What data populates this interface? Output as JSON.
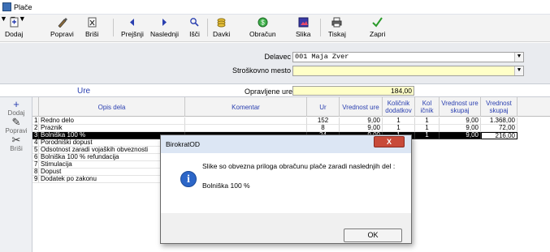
{
  "window": {
    "title": "Plače"
  },
  "toolbar": {
    "buttons": [
      {
        "label": "Dodaj"
      },
      {
        "label": "Popravi"
      },
      {
        "label": "Briši"
      },
      {
        "label": "Prejšnji"
      },
      {
        "label": "Naslednji"
      },
      {
        "label": "Išči"
      },
      {
        "label": "Davki"
      },
      {
        "label": "Obračun"
      },
      {
        "label": "Slika"
      },
      {
        "label": "Tiskaj"
      },
      {
        "label": "Zapri"
      }
    ]
  },
  "form": {
    "delavec_label": "Delavec",
    "delavec_value": "001 Maja Zver",
    "stroskovno_label": "Stroškovno mesto",
    "stroskovno_value": ""
  },
  "ure_section": {
    "title": "Ure",
    "opravljene_label": "Opravljene ure",
    "opravljene_value": "184,00"
  },
  "side_actions": [
    {
      "label": "Dodaj"
    },
    {
      "label": "Popravi"
    },
    {
      "label": "Briši"
    }
  ],
  "table": {
    "headers": [
      "",
      "Opis dela",
      "Komentar",
      "Ur",
      "Vrednost ure",
      "Količnik dodatkov",
      "Kol ičnik",
      "Vrednost ure skupaj",
      "Vrednost skupaj"
    ],
    "rows": [
      {
        "n": "1",
        "opis": "Redno delo",
        "komentar": "",
        "ur": "152",
        "vrure": "9,00",
        "koldod": "1",
        "kol": "1",
        "vrskup": "9,00",
        "skupaj": "1.368,00"
      },
      {
        "n": "2",
        "opis": "Praznik",
        "komentar": "",
        "ur": "8",
        "vrure": "9,00",
        "koldod": "1",
        "kol": "1",
        "vrskup": "9,00",
        "skupaj": "72,00"
      },
      {
        "n": "3",
        "opis": "Bolniška 100 %",
        "komentar": "",
        "ur": "24",
        "vrure": "9,00",
        "koldod": "1",
        "kol": "1",
        "vrskup": "9,00",
        "skupaj": "216,00"
      },
      {
        "n": "4",
        "opis": "Porodniški dopust"
      },
      {
        "n": "5",
        "opis": "Odsotnost zaradi vojaških obveznosti"
      },
      {
        "n": "6",
        "opis": "Bolniška 100 % refundacija"
      },
      {
        "n": "7",
        "opis": "Stimulacija"
      },
      {
        "n": "8",
        "opis": "Dopust"
      },
      {
        "n": "9",
        "opis": "Dodatek po zakonu"
      }
    ]
  },
  "dialog": {
    "title": "BirokratOD",
    "message": "Slike so obvezna priloga obračunu plače zaradi naslednjih del :",
    "detail": "Bolniška 100 %",
    "ok_label": "OK",
    "close_label": "X"
  },
  "colors": {
    "accent": "#2a3fb0",
    "input_yellow": "#ffffc8",
    "selection": "#000000",
    "close_red": "#c84b3a"
  }
}
